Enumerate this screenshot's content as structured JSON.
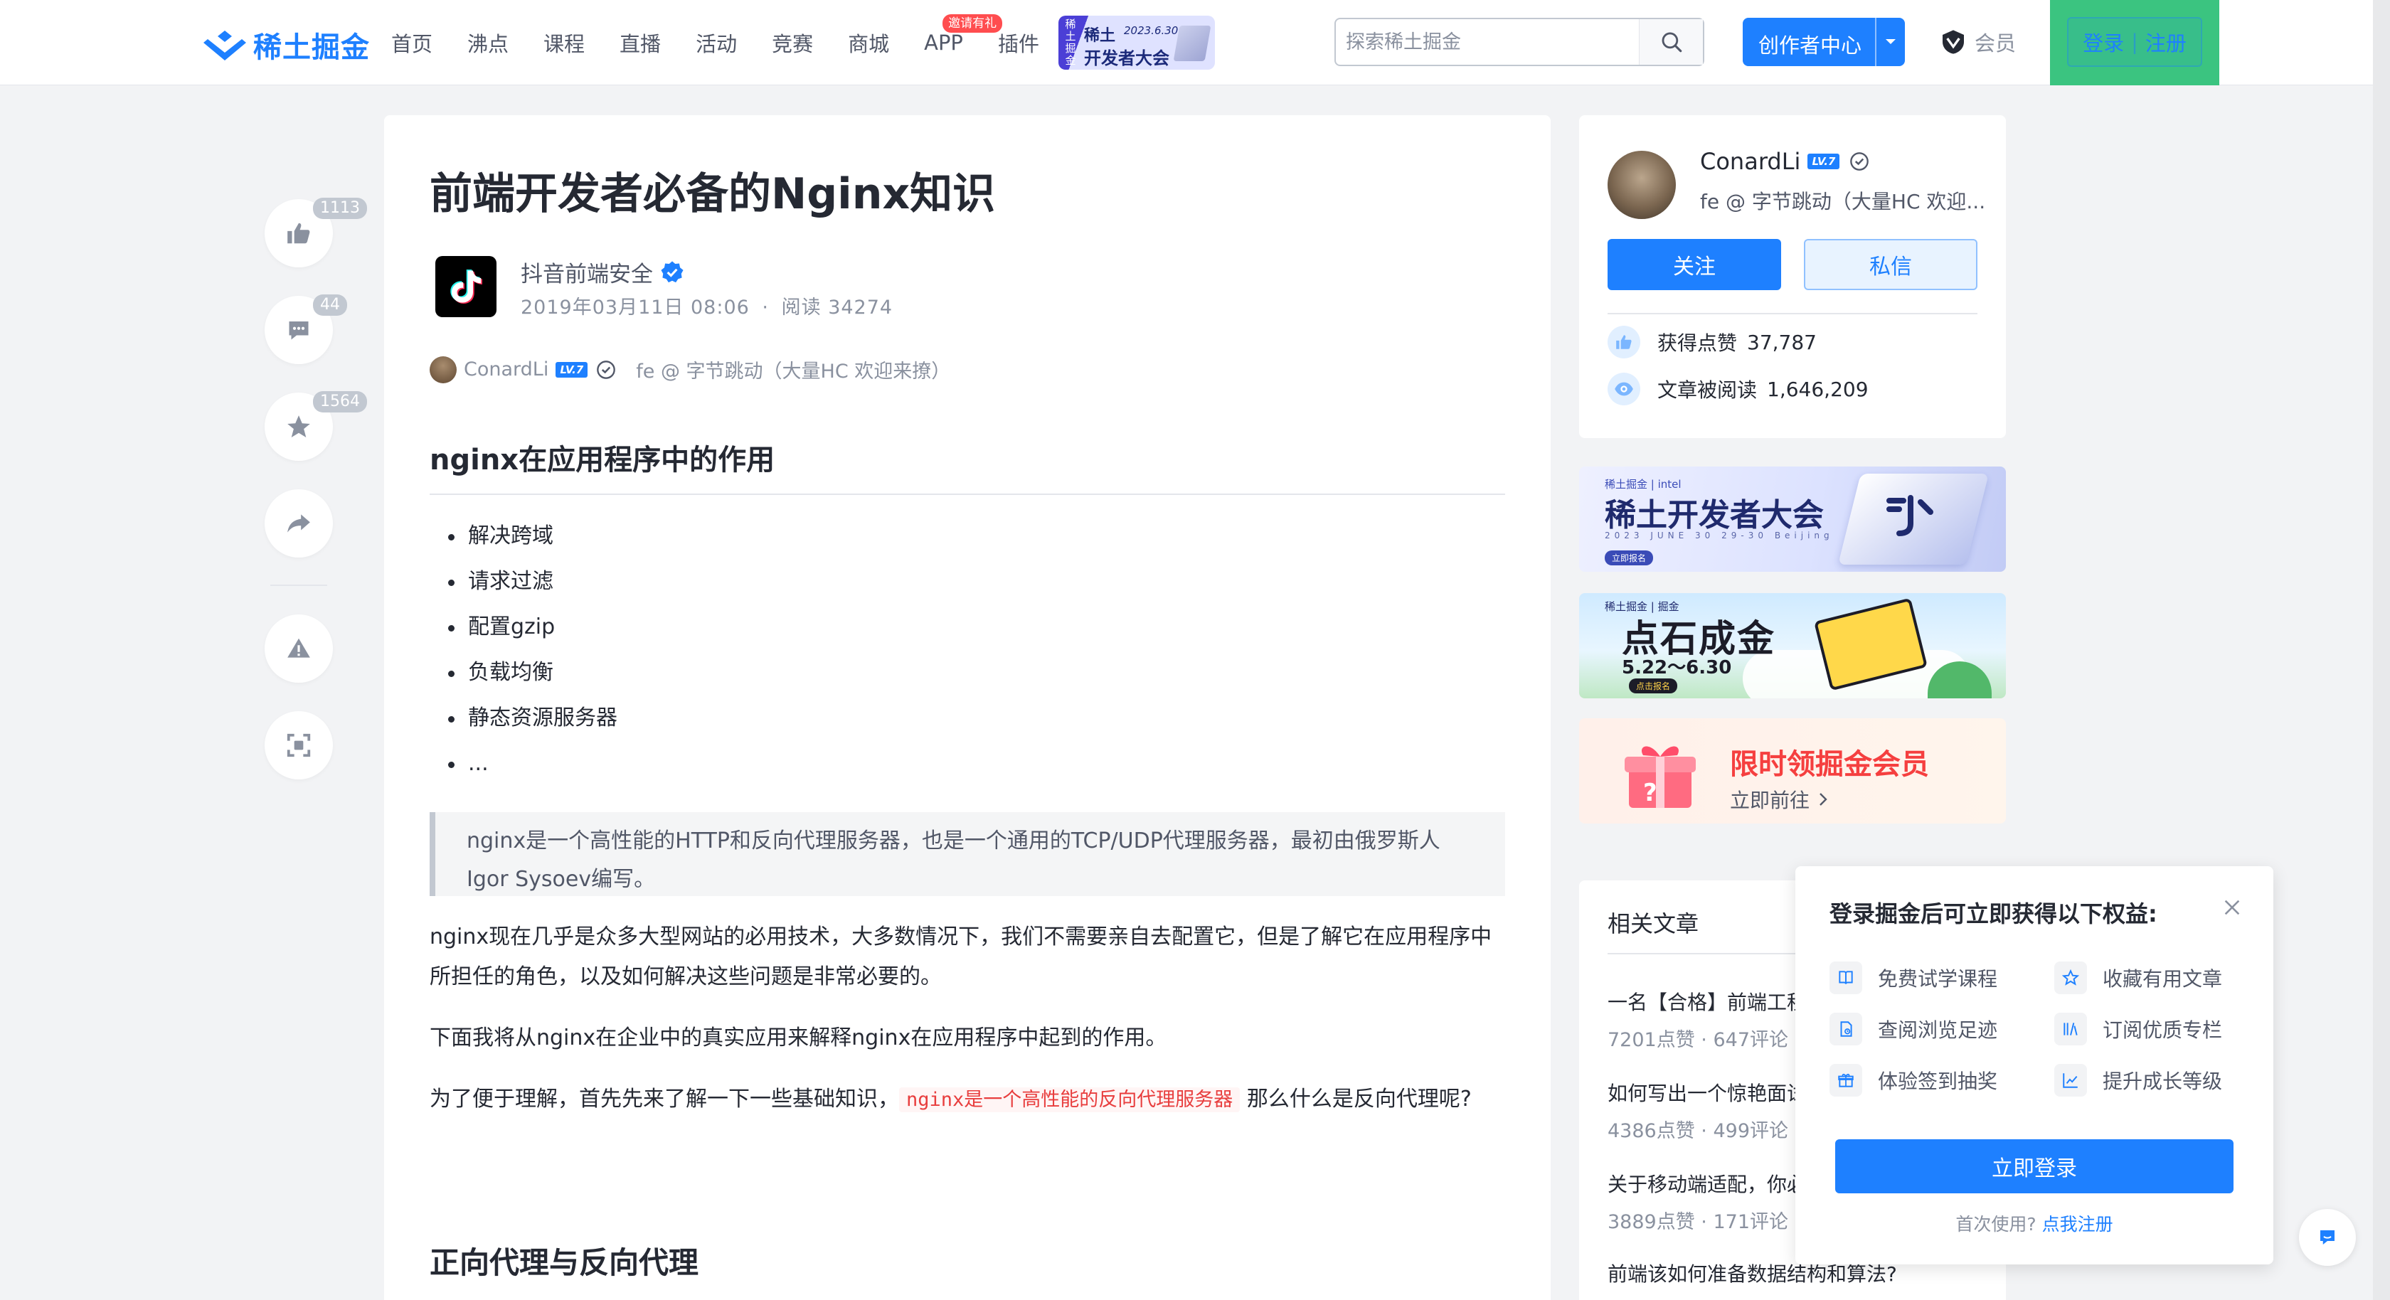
{
  "colors": {
    "brand": "#1e80ff",
    "text": "#252933",
    "muted": "#8a919f",
    "danger": "#f53f3f",
    "login_bg": "#3bc480"
  },
  "header": {
    "logo": "稀土掘金",
    "nav": [
      "首页",
      "沸点",
      "课程",
      "直播",
      "活动",
      "竞赛",
      "商城",
      "APP",
      "插件"
    ],
    "app_badge": "邀请有礼",
    "promo": {
      "side": "稀土\n掘金",
      "line1": "稀土",
      "date": "2023.6.30",
      "line2": "开发者大会"
    },
    "search_placeholder": "探索稀土掘金",
    "creator": "创作者中心",
    "vip": "会员",
    "login": "登录",
    "register": "注册",
    "login_sep": "|"
  },
  "rail": {
    "likes": "1113",
    "comments": "44",
    "collects": "1564"
  },
  "article": {
    "title": "前端开发者必备的Nginx知识",
    "author": "抖音前端安全",
    "date": "2019年03月11日 08:06",
    "reads": "阅读 34274",
    "meta_sep": "·",
    "sub_author": "ConardLi",
    "sub_level": "LV.7",
    "sub_desc": "fe @ 字节跳动（大量HC 欢迎来撩）",
    "h2_1": "nginx在应用程序中的作用",
    "list": [
      "解决跨域",
      "请求过滤",
      "配置gzip",
      "负载均衡",
      "静态资源服务器",
      "..."
    ],
    "quote": "nginx是一个高性能的HTTP和反向代理服务器，也是一个通用的TCP/UDP代理服务器，最初由俄罗斯人Igor Sysoev编写。",
    "p1": "nginx现在几乎是众多大型网站的必用技术，大多数情况下，我们不需要亲自去配置它，但是了解它在应用程序中所担任的角色，以及如何解决这些问题是非常必要的。",
    "p2": "下面我将从nginx在企业中的真实应用来解释nginx在应用程序中起到的作用。",
    "p3_pre": "为了便于理解，首先先来了解一下一些基础知识，",
    "p3_code": "nginx是一个高性能的反向代理服务器",
    "p3_post": " 那么什么是反向代理呢?",
    "h2_2": "正向代理与反向代理"
  },
  "author_card": {
    "name": "ConardLi",
    "level": "LV.7",
    "desc": "fe @ 字节跳动（大量HC 欢迎...",
    "follow": "关注",
    "message": "私信",
    "likes_label": "获得点赞",
    "likes": "37,787",
    "reads_label": "文章被阅读",
    "reads": "1,646,209"
  },
  "banners": {
    "b1_top": "稀土掘金 | intel",
    "b1_title": "稀土开发者大会",
    "b1_sub": "2023 JUNE 30 29-30 Beijing",
    "b1_btn": "立即报名",
    "b2_top": "稀土掘金 | 掘金",
    "b2_title": "点石成金",
    "b2_date": "5.22～6.30",
    "b2_btn": "点击报名",
    "b3_title": "限时领掘金会员",
    "b3_sub": "立即前往"
  },
  "related": {
    "title": "相关文章",
    "items": [
      {
        "title": "一名【合格】前端工程师的自检清单",
        "meta": "7201点赞 · 647评论"
      },
      {
        "title": "如何写出一个惊艳面试官的深拷贝?",
        "meta": "4386点赞 · 499评论"
      },
      {
        "title": "关于移动端适配，你必须要知道的",
        "meta": "3889点赞 · 171评论"
      },
      {
        "title": "前端该如何准备数据结构和算法?",
        "meta": ""
      }
    ]
  },
  "popup": {
    "title": "登录掘金后可立即获得以下权益:",
    "benefits": [
      "免费试学课程",
      "收藏有用文章",
      "查阅浏览足迹",
      "订阅优质专栏",
      "体验签到抽奖",
      "提升成长等级"
    ],
    "button": "立即登录",
    "first_use": "首次使用?",
    "register": "点我注册"
  }
}
